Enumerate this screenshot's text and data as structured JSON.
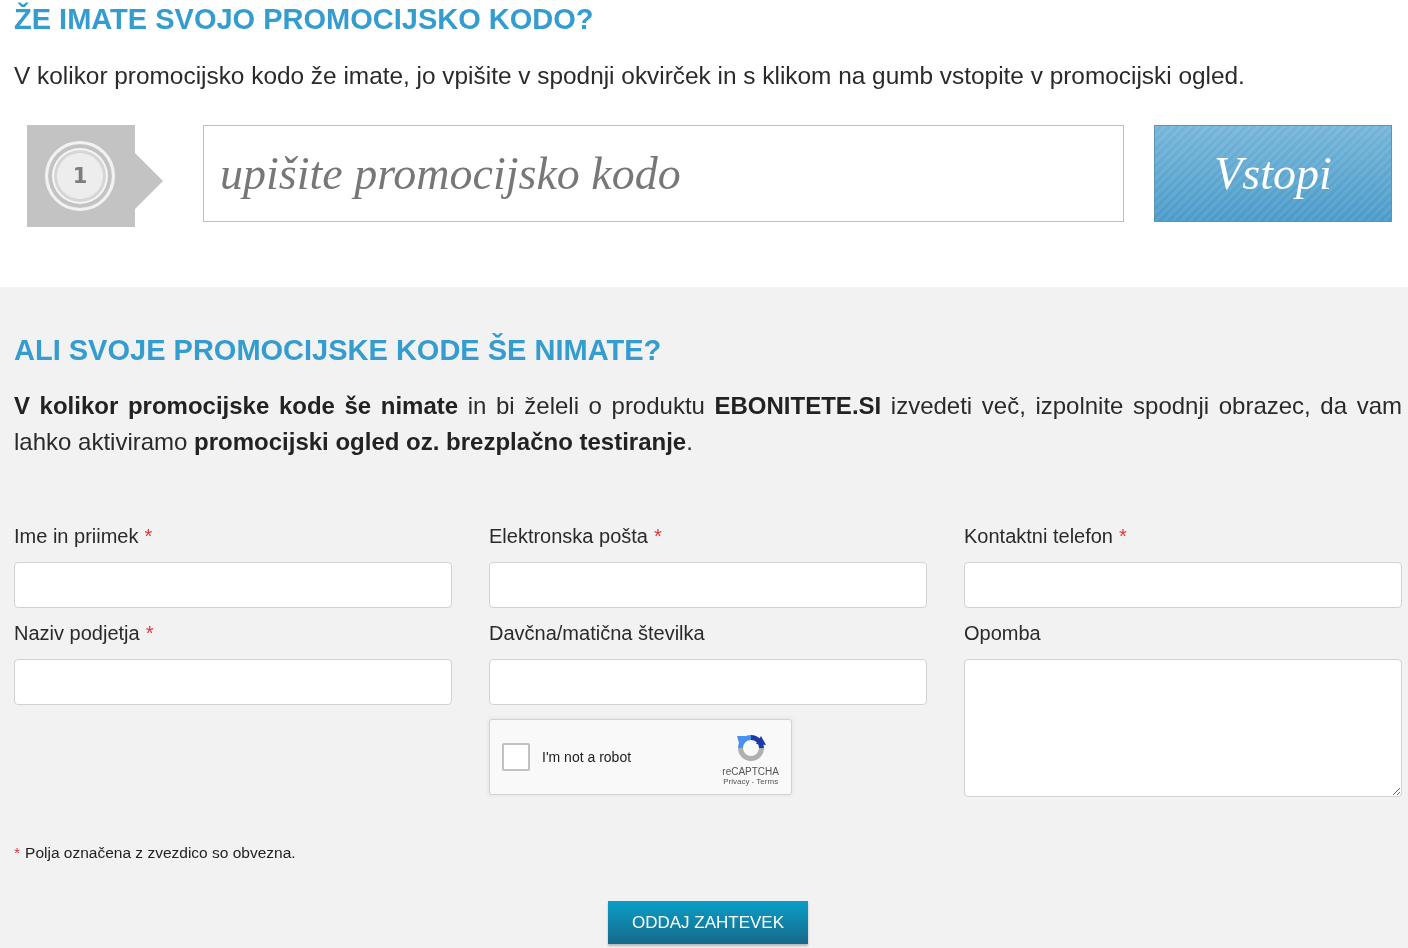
{
  "promo_section": {
    "heading": "ŽE IMATE SVOJO PROMOCIJSKO KODO?",
    "text": "V kolikor promocijsko kodo že imate, jo vpišite v spodnji okvirček in s klikom na gumb vstopite v promocijski ogled.",
    "step_number": "1",
    "code_field": {
      "placeholder": "upišite promocijsko kodo"
    },
    "enter_button": "Vstopi"
  },
  "request_section": {
    "heading": "ALI SVOJE PROMOCIJSKE KODE ŠE NIMATE?",
    "text": "**V kolikor promocijske kode še nimate** in bi želeli o produktu **EBONITETE.SI** izvedeti več, izpolnite spodnji obrazec, da vam lahko aktiviramo **promocijski ogled oz. brezplačno testiranje**.",
    "fields": [
      {
        "label": "Ime in priimek",
        "required_mark": "*",
        "kind": "input"
      },
      {
        "label": "Elektronska pošta",
        "required_mark": "*",
        "kind": "input"
      },
      {
        "label": "Kontaktni telefon",
        "required_mark": "*",
        "kind": "input"
      },
      {
        "label": "Naziv podjetja",
        "required_mark": "*",
        "kind": "input"
      },
      {
        "label": "Davčna/matična številka",
        "kind": "input"
      },
      {
        "label": "Opomba",
        "kind": "textarea"
      }
    ],
    "captcha": {
      "label": "I'm not a robot",
      "checked": false,
      "brand": "reCAPTCHA",
      "links": "Privacy - Terms"
    },
    "required_note": {
      "mark": "*",
      "text": "Polja označena z zvezdico so obvezna."
    },
    "submit_button": "ODDAJ ZAHTEVEK"
  }
}
